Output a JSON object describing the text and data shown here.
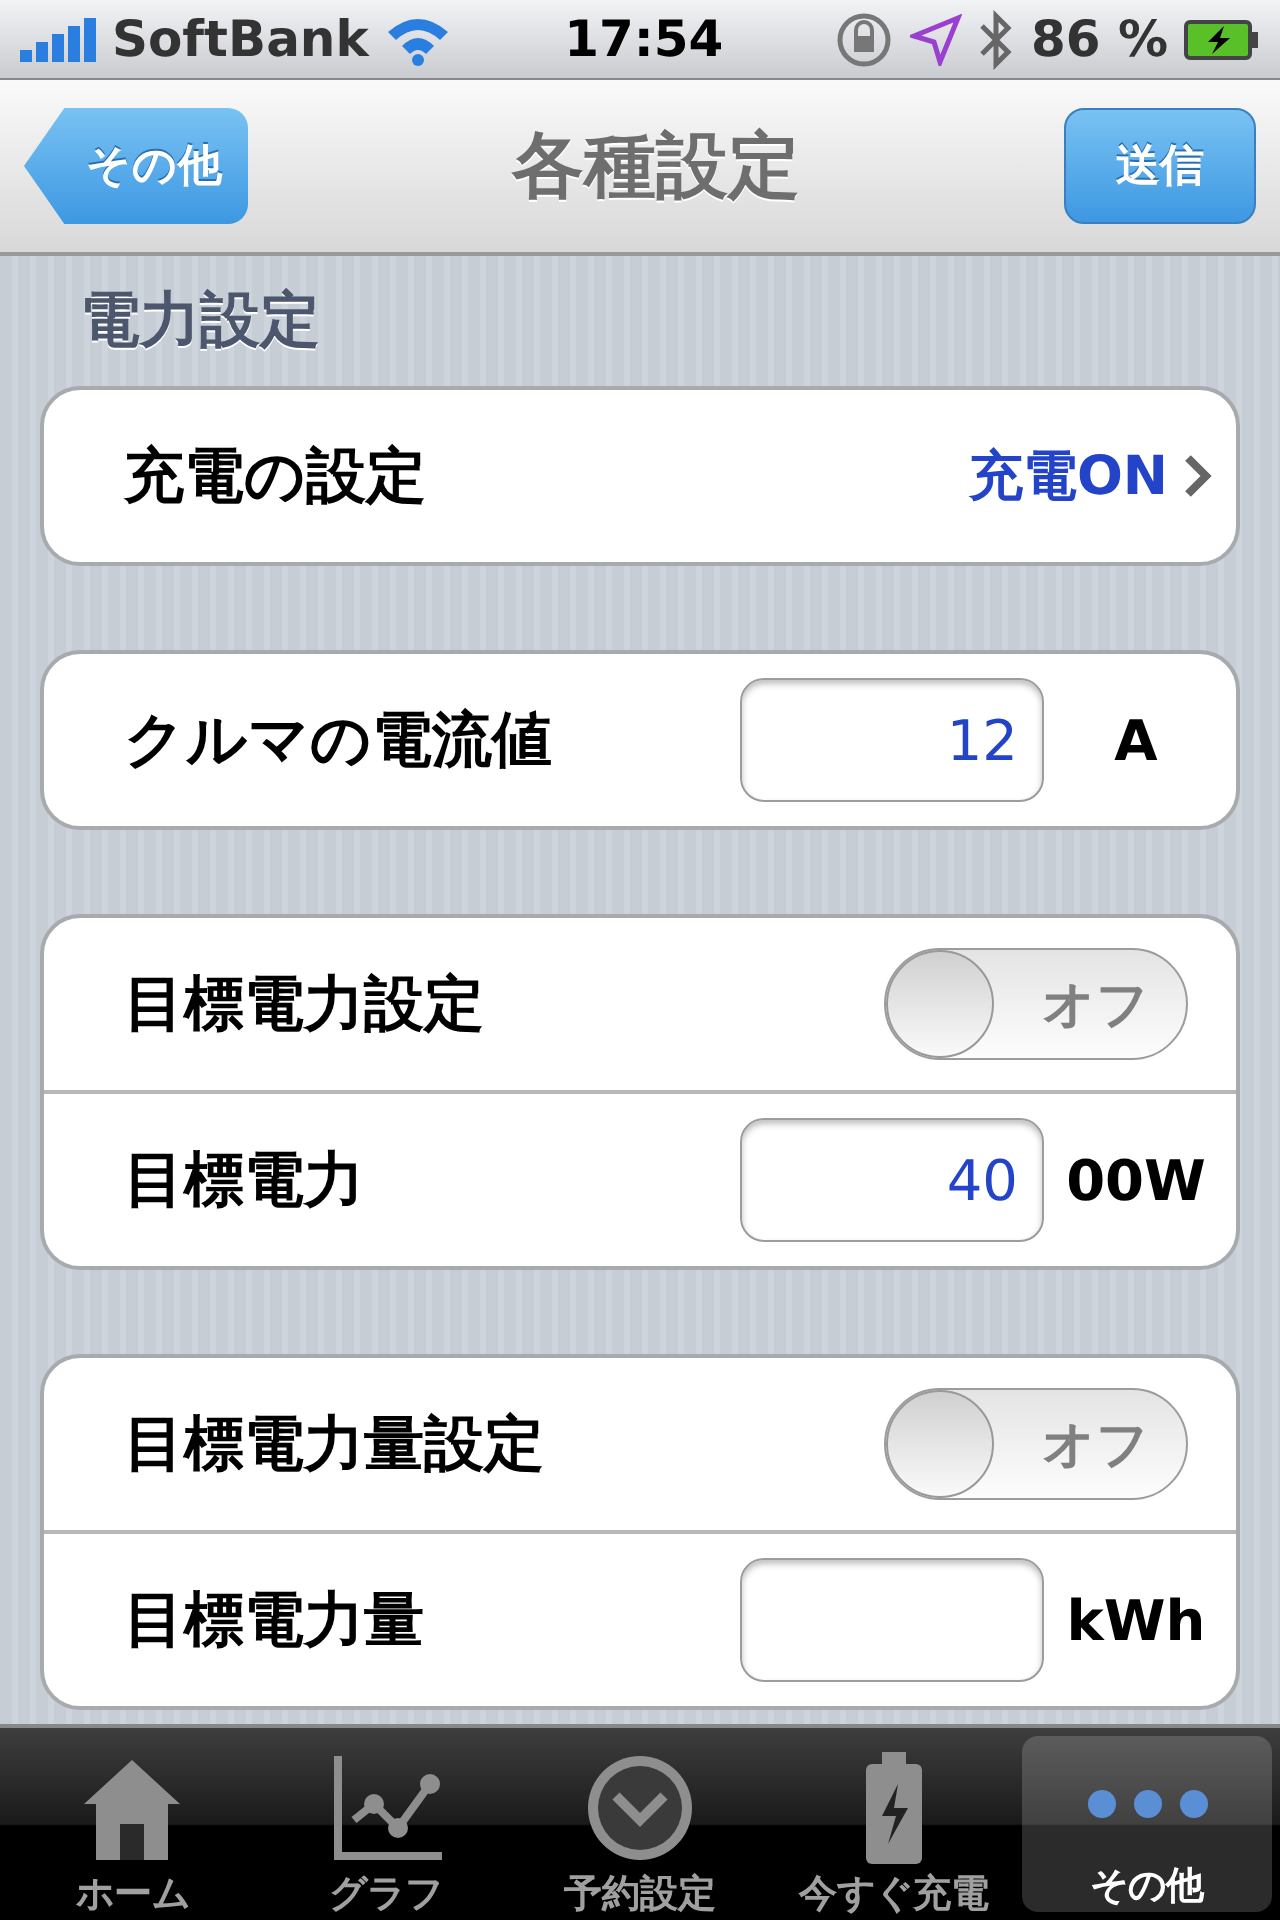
{
  "status_bar": {
    "carrier": "SoftBank",
    "time": "17:54",
    "battery": "86 %"
  },
  "nav_bar": {
    "back": "その他",
    "title": "各種設定",
    "action": "送信"
  },
  "section_title": "電力設定",
  "groups": [
    {
      "rows": [
        {
          "kind": "disclosure",
          "label": "充電の設定",
          "value": "充電ON"
        }
      ]
    },
    {
      "rows": [
        {
          "kind": "field",
          "label": "クルマの電流値",
          "value": "12",
          "unit": "A"
        }
      ]
    },
    {
      "rows": [
        {
          "kind": "switch",
          "label": "目標電力設定",
          "on": false,
          "switch_label": "オフ"
        },
        {
          "kind": "field",
          "label": "目標電力",
          "value": "40",
          "unit": "00W"
        }
      ]
    },
    {
      "rows": [
        {
          "kind": "switch",
          "label": "目標電力量設定",
          "on": false,
          "switch_label": "オフ"
        },
        {
          "kind": "field",
          "label": "目標電力量",
          "unit": "kWh"
        }
      ]
    }
  ],
  "tab_bar": [
    {
      "label": "ホーム",
      "selected": false
    },
    {
      "label": "グラフ",
      "selected": false
    },
    {
      "label": "予約設定",
      "selected": false
    },
    {
      "label": "今すぐ充電",
      "selected": false
    },
    {
      "label": "その他",
      "selected": true
    }
  ]
}
